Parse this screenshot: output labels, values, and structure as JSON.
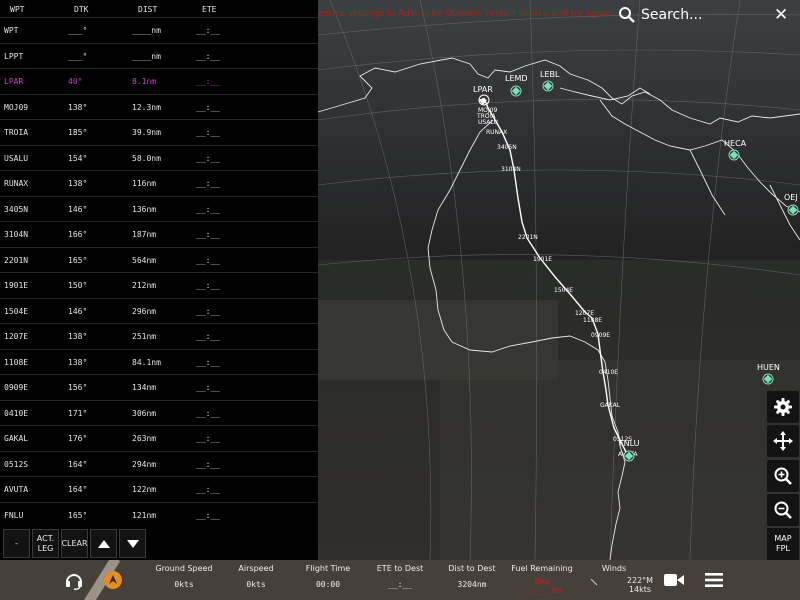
{
  "notice": "educe settings in Advanced Options, restart device and try again",
  "search": {
    "label": "Search..."
  },
  "fpl": {
    "headers": {
      "wpt": "WPT",
      "dtk": "DTK",
      "dist": "DIST",
      "ete": "ETE"
    },
    "rows": [
      {
        "wpt": "WPT",
        "dtk": "___°",
        "dist": "____nm",
        "ete": "__:__",
        "active": false
      },
      {
        "wpt": "LPPT",
        "dtk": "___°",
        "dist": "____nm",
        "ete": "__:__",
        "active": false
      },
      {
        "wpt": "LPAR",
        "dtk": "40°",
        "dist": "8.1nm",
        "ete": "__:__",
        "active": true
      },
      {
        "wpt": "MOJ09",
        "dtk": "138°",
        "dist": "12.3nm",
        "ete": "__:__",
        "active": false
      },
      {
        "wpt": "TROIA",
        "dtk": "185°",
        "dist": "39.9nm",
        "ete": "__:__",
        "active": false
      },
      {
        "wpt": "USALU",
        "dtk": "154°",
        "dist": "58.0nm",
        "ete": "__:__",
        "active": false
      },
      {
        "wpt": "RUNAX",
        "dtk": "138°",
        "dist": "116nm",
        "ete": "__:__",
        "active": false
      },
      {
        "wpt": "3405N",
        "dtk": "146°",
        "dist": "136nm",
        "ete": "__:__",
        "active": false
      },
      {
        "wpt": "3104N",
        "dtk": "166°",
        "dist": "187nm",
        "ete": "__:__",
        "active": false
      },
      {
        "wpt": "2201N",
        "dtk": "165°",
        "dist": "564nm",
        "ete": "__:__",
        "active": false
      },
      {
        "wpt": "1901E",
        "dtk": "150°",
        "dist": "212nm",
        "ete": "__:__",
        "active": false
      },
      {
        "wpt": "1504E",
        "dtk": "146°",
        "dist": "296nm",
        "ete": "__:__",
        "active": false
      },
      {
        "wpt": "1207E",
        "dtk": "138°",
        "dist": "251nm",
        "ete": "__:__",
        "active": false
      },
      {
        "wpt": "1108E",
        "dtk": "138°",
        "dist": "84.1nm",
        "ete": "__:__",
        "active": false
      },
      {
        "wpt": "0909E",
        "dtk": "156°",
        "dist": "134nm",
        "ete": "__:__",
        "active": false
      },
      {
        "wpt": "0410E",
        "dtk": "171°",
        "dist": "306nm",
        "ete": "__:__",
        "active": false
      },
      {
        "wpt": "GAKAL",
        "dtk": "176°",
        "dist": "263nm",
        "ete": "__:__",
        "active": false
      },
      {
        "wpt": "0512S",
        "dtk": "164°",
        "dist": "294nm",
        "ete": "__:__",
        "active": false
      },
      {
        "wpt": "AVUTA",
        "dtk": "164°",
        "dist": "122nm",
        "ete": "__:__",
        "active": false
      },
      {
        "wpt": "FNLU",
        "dtk": "165°",
        "dist": "121nm",
        "ete": "__:__",
        "active": false
      }
    ],
    "buttons": {
      "dash": "-",
      "act_leg_1": "ACT.",
      "act_leg_2": "LEG",
      "clear": "CLEAR"
    }
  },
  "map": {
    "airports": [
      "LEMD",
      "LEBL",
      "LPAR",
      "HECA",
      "OEJ",
      "HUEN",
      "FNLU"
    ],
    "route_labels": [
      "MOJ09",
      "TROIA",
      "USALU",
      "RUNAX",
      "3405N",
      "3104N",
      "2201N",
      "1901E",
      "1504E",
      "1207E",
      "1108E",
      "0909E",
      "0410E",
      "GAKAL",
      "0512S",
      "AVUTA"
    ]
  },
  "tools": {
    "map_fpl_1": "MAP",
    "map_fpl_2": "FPL"
  },
  "stats": {
    "ground_speed": {
      "label": "Ground Speed",
      "value": "0kts"
    },
    "airspeed": {
      "label": "Airspeed",
      "value": "0kts"
    },
    "flight_time": {
      "label": "Flight Time",
      "value": "00:00"
    },
    "ete_to_dest": {
      "label": "ETE to Dest",
      "value": "__:__"
    },
    "dist_to_dest": {
      "label": "Dist to Dest",
      "value": "3204nm"
    },
    "fuel_remaining": {
      "label": "Fuel Remaining",
      "value_top": "0kg",
      "value_bottom": "__:__ 0%"
    },
    "winds": {
      "label": "Winds",
      "direction": "222°M",
      "speed": "14kts"
    }
  },
  "colors": {
    "active_waypoint": "#d13ad6",
    "fuel_warning": "#d21d1d",
    "airport_marker": "#7fe0b5"
  },
  "icons": {
    "search": "search-icon",
    "close": "close-icon",
    "settings": "gear-icon",
    "pan": "move-arrows-icon",
    "zoom_in": "zoom-in-icon",
    "zoom_out": "zoom-out-icon",
    "headset": "headset-icon",
    "atc": "atc-radar-icon",
    "camera": "video-camera-icon",
    "menu": "hamburger-menu-icon"
  }
}
